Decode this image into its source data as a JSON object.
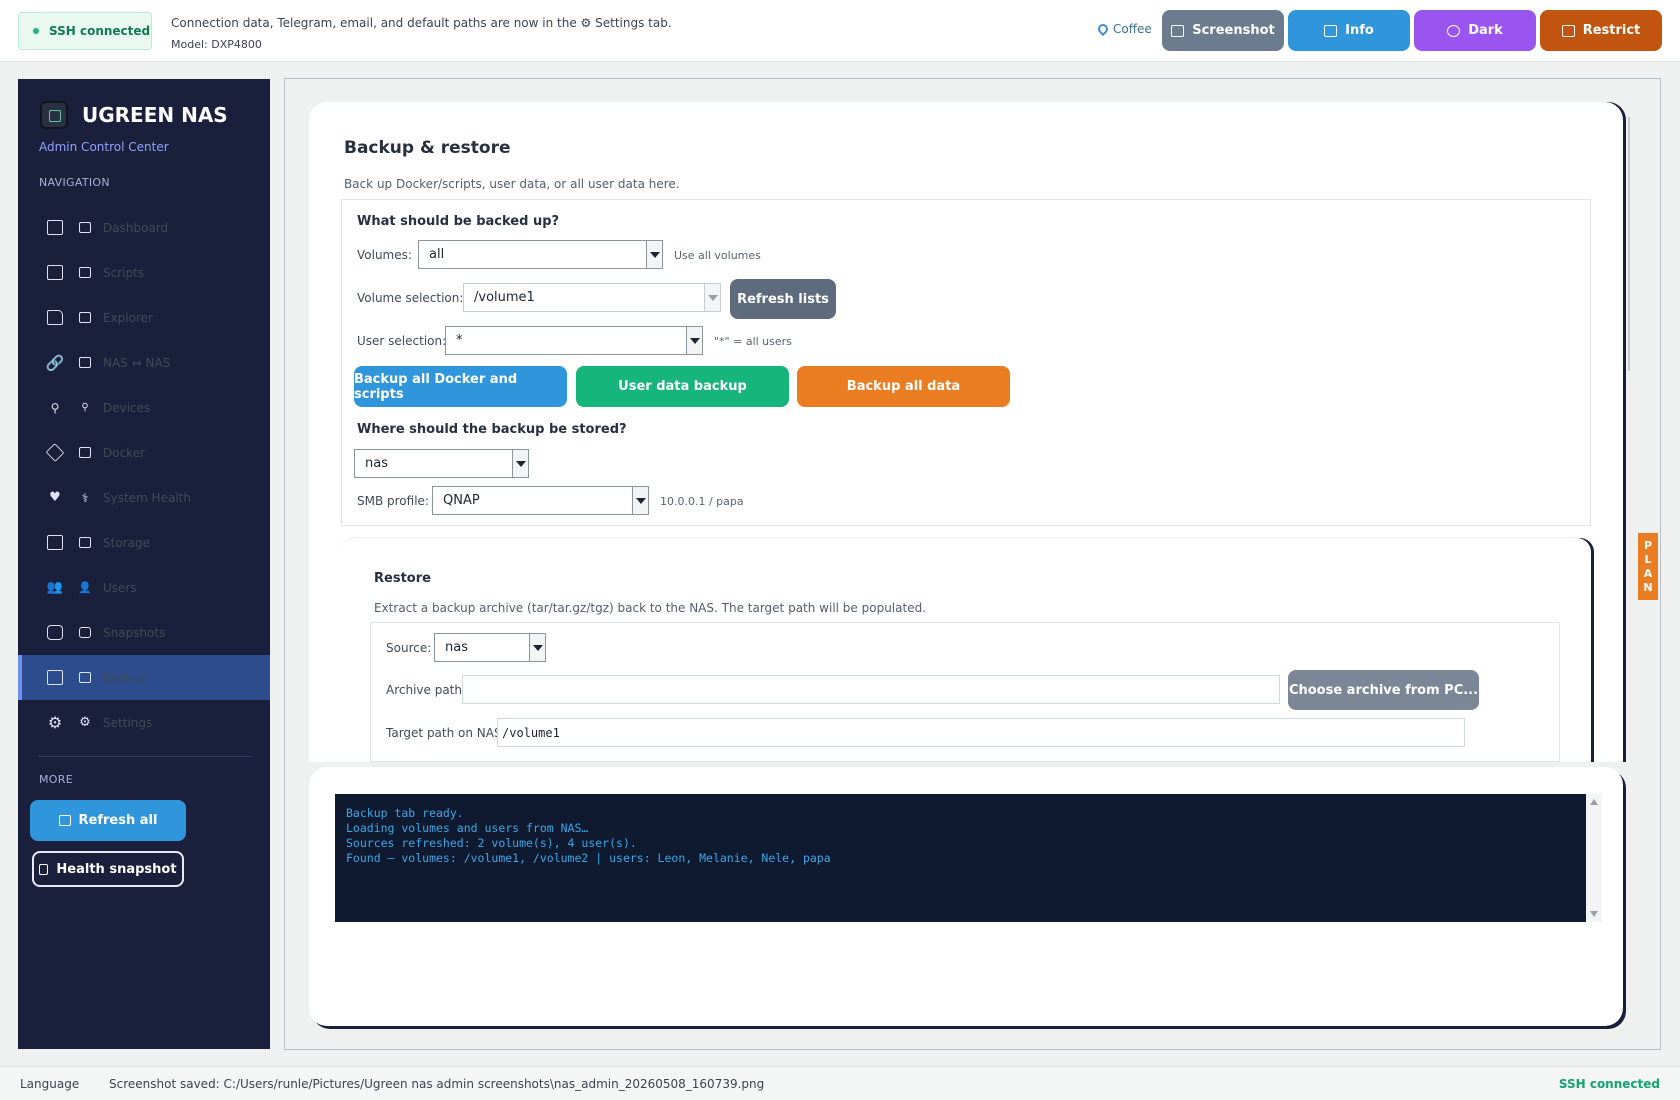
{
  "topbar": {
    "ssh_status": "SSH connected",
    "info_line1": "Connection data, Telegram, email, and default paths are now in the ⚙ Settings tab.",
    "info_line2": "Model: DXP4800",
    "coffee_label": "Coffee",
    "buttons": {
      "screenshot": "Screenshot",
      "info": "Info",
      "dark": "Dark",
      "restrict": "Restrict"
    }
  },
  "sidebar": {
    "title": "UGREEN NAS",
    "subtitle": "Admin Control Center",
    "nav_heading": "NAVIGATION",
    "items": [
      {
        "label": "Dashboard",
        "icon": "chart-icon"
      },
      {
        "label": "Scripts",
        "icon": "scroll-icon"
      },
      {
        "label": "Explorer",
        "icon": "folder-icon"
      },
      {
        "label": "NAS ↔ NAS",
        "icon": "link-icon"
      },
      {
        "label": "Devices",
        "icon": "network-icon"
      },
      {
        "label": "Docker",
        "icon": "package-icon"
      },
      {
        "label": "System Health",
        "icon": "heart-icon"
      },
      {
        "label": "Storage",
        "icon": "disk-icon"
      },
      {
        "label": "Users",
        "icon": "users-icon"
      },
      {
        "label": "Snapshots",
        "icon": "camera-icon"
      },
      {
        "label": "Backup",
        "icon": "backup-icon"
      },
      {
        "label": "Settings",
        "icon": "gear-icon"
      }
    ],
    "active_item": "Backup",
    "more_heading": "MORE",
    "refresh_all": "Refresh all",
    "health_snapshot": "Health snapshot"
  },
  "backup": {
    "title": "Backup & restore",
    "description": "Back up Docker/scripts, user data, or all user data here.",
    "what_heading": "What should be backed up?",
    "volumes_label": "Volumes:",
    "volumes_value": "all",
    "volumes_hint": "Use all volumes",
    "volume_selection_label": "Volume selection:",
    "volume_selection_value": "/volume1",
    "refresh_lists": "Refresh lists",
    "user_selection_label": "User selection:",
    "user_selection_value": "*",
    "user_selection_hint": "\"*\" = all users",
    "btn_docker": "Backup all Docker and scripts",
    "btn_userdata": "User data backup",
    "btn_all": "Backup all data",
    "where_heading": "Where should the backup be stored?",
    "destination_value": "nas",
    "smb_label": "SMB profile:",
    "smb_value": "QNAP",
    "smb_hint": "10.0.0.1 / papa"
  },
  "restore": {
    "title": "Restore",
    "description": "Extract a backup archive (tar/tar.gz/tgz) back to the NAS. The target path will be populated.",
    "source_label": "Source:",
    "source_value": "nas",
    "archive_label": "Archive path:",
    "archive_value": "",
    "choose_archive": "Choose archive from PC...",
    "target_label": "Target path on NAS:",
    "target_value": "/volume1"
  },
  "plan_tab": [
    "P",
    "L",
    "A",
    "N"
  ],
  "console": {
    "lines": [
      "Backup tab ready.",
      "Loading volumes and users from NAS…",
      "Sources refreshed: 2 volume(s), 4 user(s).",
      "Found — volumes: /volume1, /volume2 | users: Leon, Melanie, Nele, papa"
    ]
  },
  "statusbar": {
    "language": "Language",
    "message": "Screenshot saved: C:/Users/runle/Pictures/Ugreen nas admin screenshots\\nas_admin_20260508_160739.png",
    "ssh_status": "SSH connected"
  }
}
